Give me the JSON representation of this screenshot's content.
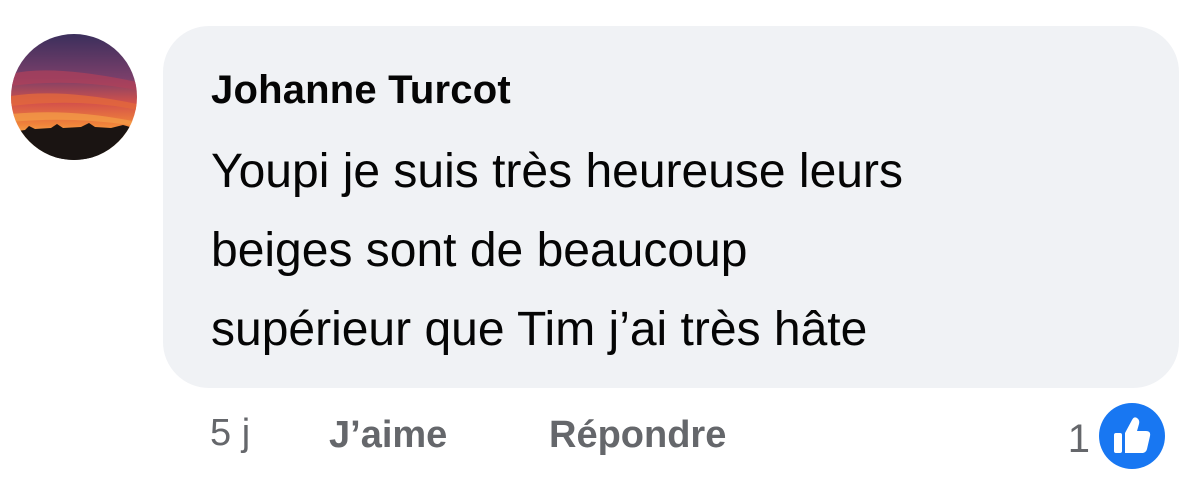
{
  "comment": {
    "author": "Johanne Turcot",
    "text_lines": [
      "Youpi je suis très heureuse leurs",
      "beiges sont de beaucoup",
      "supérieur que Tim j’ai très hâte"
    ],
    "avatar_icon": "sunset-photo-avatar"
  },
  "actions": {
    "time": "5 j",
    "like_label": "J’aime",
    "reply_label": "Répondre"
  },
  "reactions": {
    "count": "1",
    "icon": "thumbs-up-icon",
    "color": "#1877f2"
  },
  "colors": {
    "bubble": "#f0f2f5",
    "text": "#050505",
    "secondary": "#65676b"
  }
}
